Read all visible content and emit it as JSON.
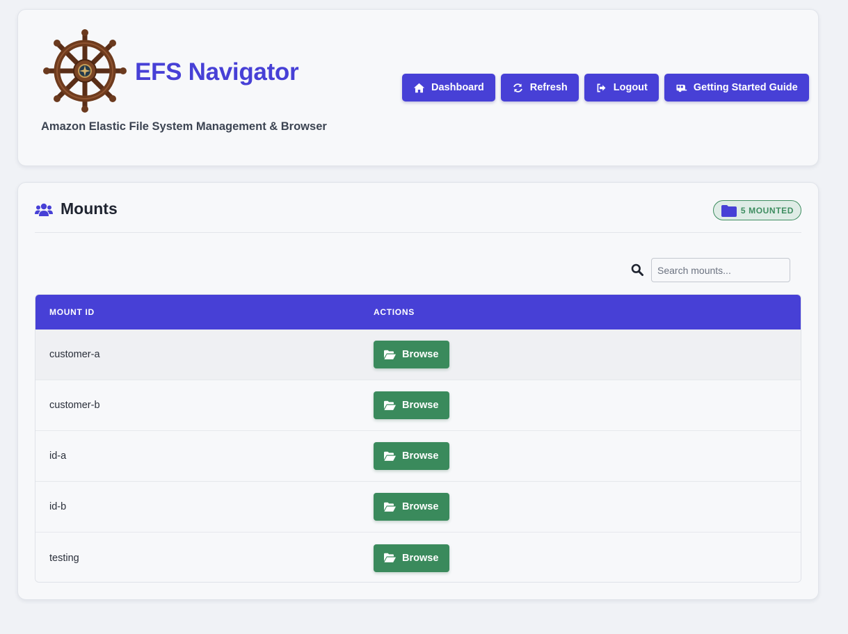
{
  "header": {
    "logo_icon": "ship-wheel-icon",
    "title": "EFS Navigator",
    "subtitle": "Amazon Elastic File System Management & Browser",
    "accent_color": "#4740d6",
    "nav": [
      {
        "label": "Dashboard",
        "icon": "home-icon"
      },
      {
        "label": "Refresh",
        "icon": "refresh-icon"
      },
      {
        "label": "Logout",
        "icon": "logout-icon"
      },
      {
        "label": "Getting Started Guide",
        "icon": "caravan-icon"
      }
    ]
  },
  "mounts": {
    "icon": "users-icon",
    "title": "Mounts",
    "badge": {
      "icon": "folder-icon",
      "label": "5 MOUNTED",
      "color": "#3e8d60"
    },
    "search": {
      "placeholder": "Search mounts...",
      "value": ""
    },
    "table": {
      "columns": [
        "MOUNT ID",
        "ACTIONS"
      ],
      "header_color": "#4740d6",
      "rows": [
        {
          "mount_id": "customer-a",
          "action": "Browse"
        },
        {
          "mount_id": "customer-b",
          "action": "Browse"
        },
        {
          "mount_id": "id-a",
          "action": "Browse"
        },
        {
          "mount_id": "id-b",
          "action": "Browse"
        },
        {
          "mount_id": "testing",
          "action": "Browse"
        }
      ],
      "action_color": "#3a8a5c",
      "action_icon": "folder-open-icon"
    }
  }
}
